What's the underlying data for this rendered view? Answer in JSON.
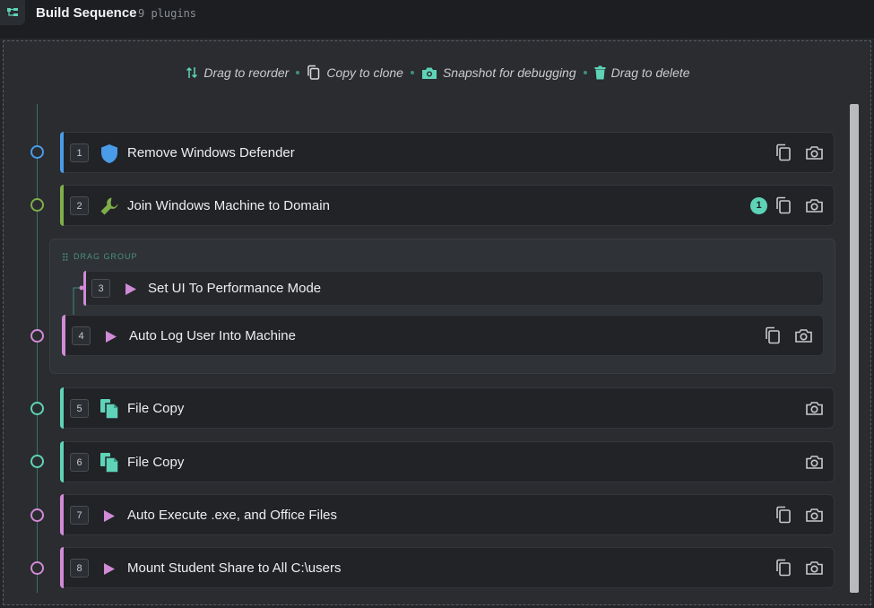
{
  "header": {
    "title": "Build Sequence",
    "count": "9 plugins"
  },
  "hints": [
    {
      "icon": "reorder-arrows-icon",
      "label": "Drag to reorder"
    },
    {
      "icon": "copy-icon",
      "label": "Copy to clone"
    },
    {
      "icon": "camera-icon",
      "label": "Snapshot for debugging"
    },
    {
      "icon": "trash-icon",
      "label": "Drag to delete"
    }
  ],
  "group": {
    "label": "DRAG GROUP"
  },
  "colors": {
    "blue": "#4a9be8",
    "green": "#7fae4a",
    "pink": "#d08ad6",
    "teal": "#5ed3b7"
  },
  "items": [
    {
      "num": "1",
      "label": "Remove Windows Defender",
      "icon": "shield-icon"
    },
    {
      "num": "2",
      "label": "Join Windows Machine to Domain",
      "icon": "wrench-icon",
      "badge": "1"
    },
    {
      "num": "3",
      "label": "Set UI To Performance Mode",
      "icon": "play-icon"
    },
    {
      "num": "4",
      "label": "Auto Log User Into Machine",
      "icon": "play-icon"
    },
    {
      "num": "5",
      "label": "File Copy",
      "icon": "file-copy-icon"
    },
    {
      "num": "6",
      "label": "File Copy",
      "icon": "file-copy-icon"
    },
    {
      "num": "7",
      "label": "Auto Execute .exe, and Office Files",
      "icon": "play-icon"
    },
    {
      "num": "8",
      "label": "Mount Student Share to All C:\\users",
      "icon": "play-icon"
    }
  ]
}
